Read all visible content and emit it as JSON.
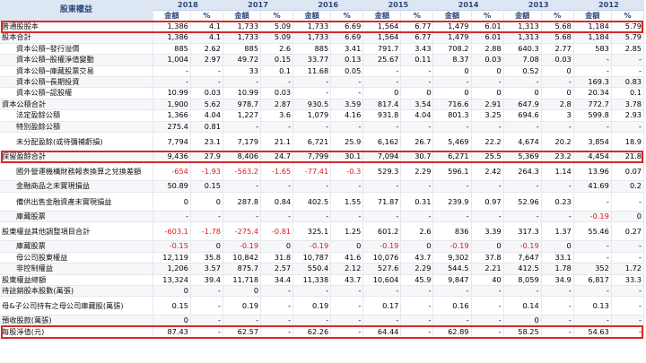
{
  "header": {
    "corner_label": "股東權益",
    "years": [
      "2018",
      "2017",
      "2016",
      "2015",
      "2014",
      "2013",
      "2012"
    ],
    "amount_label": "金額",
    "pct_label": "%"
  },
  "rows": [
    {
      "label": "普通股股本",
      "indent": 0,
      "highlight": true,
      "vals": [
        [
          "1,386",
          "4.1"
        ],
        [
          "1,733",
          "5.09"
        ],
        [
          "1,733",
          "6.69"
        ],
        [
          "1,564",
          "6.77"
        ],
        [
          "1,479",
          "6.01"
        ],
        [
          "1,313",
          "5.68"
        ],
        [
          "1,184",
          "5.79"
        ]
      ]
    },
    {
      "label": "股本合計",
      "indent": 0,
      "vals": [
        [
          "1,386",
          "4.1"
        ],
        [
          "1,733",
          "5.09"
        ],
        [
          "1,733",
          "6.69"
        ],
        [
          "1,564",
          "6.77"
        ],
        [
          "1,479",
          "6.01"
        ],
        [
          "1,313",
          "5.68"
        ],
        [
          "1,184",
          "5.79"
        ]
      ]
    },
    {
      "label": "資本公積─發行溢價",
      "indent": 1,
      "vals": [
        [
          "885",
          "2.62"
        ],
        [
          "885",
          "2.6"
        ],
        [
          "885",
          "3.41"
        ],
        [
          "791.7",
          "3.43"
        ],
        [
          "708.2",
          "2.88"
        ],
        [
          "640.3",
          "2.77"
        ],
        [
          "583",
          "2.85"
        ]
      ]
    },
    {
      "label": "資本公積─股權淨值變動",
      "indent": 1,
      "vals": [
        [
          "1,004",
          "2.97"
        ],
        [
          "49.72",
          "0.15"
        ],
        [
          "33.77",
          "0.13"
        ],
        [
          "25.67",
          "0.11"
        ],
        [
          "8.37",
          "0.03"
        ],
        [
          "7.08",
          "0.03"
        ],
        [
          "-",
          "-"
        ]
      ]
    },
    {
      "label": "資本公積─庫藏股票交易",
      "indent": 1,
      "vals": [
        [
          "-",
          "-"
        ],
        [
          "33",
          "0.1"
        ],
        [
          "11.68",
          "0.05"
        ],
        [
          "-",
          "-"
        ],
        [
          "0",
          "0"
        ],
        [
          "0.52",
          "0"
        ],
        [
          "-",
          "-"
        ]
      ]
    },
    {
      "label": "資本公積─長期投資",
      "indent": 1,
      "vals": [
        [
          "-",
          "-"
        ],
        [
          "-",
          "-"
        ],
        [
          "-",
          "-"
        ],
        [
          "-",
          "-"
        ],
        [
          "-",
          "-"
        ],
        [
          "-",
          "-"
        ],
        [
          "169.3",
          "0.83"
        ]
      ]
    },
    {
      "label": "資本公積─認股權",
      "indent": 1,
      "vals": [
        [
          "10.99",
          "0.03"
        ],
        [
          "10.99",
          "0.03"
        ],
        [
          "-",
          "-"
        ],
        [
          "0",
          "0"
        ],
        [
          "0",
          "0"
        ],
        [
          "0",
          "0"
        ],
        [
          "20.34",
          "0.1"
        ]
      ]
    },
    {
      "label": "資本公積合計",
      "indent": 0,
      "vals": [
        [
          "1,900",
          "5.62"
        ],
        [
          "978.7",
          "2.87"
        ],
        [
          "930.5",
          "3.59"
        ],
        [
          "817.4",
          "3.54"
        ],
        [
          "716.6",
          "2.91"
        ],
        [
          "647.9",
          "2.8"
        ],
        [
          "772.7",
          "3.78"
        ]
      ]
    },
    {
      "label": "法定盈餘公積",
      "indent": 1,
      "vals": [
        [
          "1,366",
          "4.04"
        ],
        [
          "1,227",
          "3.6"
        ],
        [
          "1,079",
          "4.16"
        ],
        [
          "931.8",
          "4.04"
        ],
        [
          "801.3",
          "3.25"
        ],
        [
          "694.6",
          "3"
        ],
        [
          "599.8",
          "2.93"
        ]
      ]
    },
    {
      "label": "特別盈餘公積",
      "indent": 1,
      "vals": [
        [
          "275.4",
          "0.81"
        ],
        [
          "-",
          "-"
        ],
        [
          "-",
          "-"
        ],
        [
          "-",
          "-"
        ],
        [
          "-",
          "-"
        ],
        [
          "-",
          "-"
        ],
        [
          "-",
          "-"
        ]
      ]
    },
    {
      "label": "未分配盈餘(或待彌補虧損)",
      "indent": 1,
      "tall": true,
      "vals": [
        [
          "7,794",
          "23.1"
        ],
        [
          "7,179",
          "21.1"
        ],
        [
          "6,721",
          "25.9"
        ],
        [
          "6,162",
          "26.7"
        ],
        [
          "5,469",
          "22.2"
        ],
        [
          "4,674",
          "20.2"
        ],
        [
          "3,854",
          "18.9"
        ]
      ]
    },
    {
      "label": "保留盈餘合計",
      "indent": 0,
      "highlight": true,
      "vals": [
        [
          "9,436",
          "27.9"
        ],
        [
          "8,406",
          "24.7"
        ],
        [
          "7,799",
          "30.1"
        ],
        [
          "7,094",
          "30.7"
        ],
        [
          "6,271",
          "25.5"
        ],
        [
          "5,369",
          "23.2"
        ],
        [
          "4,454",
          "21.8"
        ]
      ]
    },
    {
      "label": "國外營運機構財務報表換算之兌換差額",
      "indent": 1,
      "tall": true,
      "vals": [
        [
          "-654",
          "-1.93"
        ],
        [
          "-563.2",
          "-1.65"
        ],
        [
          "-77.41",
          "-0.3"
        ],
        [
          "529.3",
          "2.29"
        ],
        [
          "596.1",
          "2.42"
        ],
        [
          "264.3",
          "1.14"
        ],
        [
          "13.96",
          "0.07"
        ]
      ]
    },
    {
      "label": "金融商品之未實現損益",
      "indent": 1,
      "vals": [
        [
          "50.89",
          "0.15"
        ],
        [
          "-",
          "-"
        ],
        [
          "-",
          "-"
        ],
        [
          "-",
          "-"
        ],
        [
          "-",
          "-"
        ],
        [
          "-",
          "-"
        ],
        [
          "41.69",
          "0.2"
        ]
      ]
    },
    {
      "label": "備供出售金融資產未實現損益",
      "indent": 1,
      "tall": true,
      "vals": [
        [
          "0",
          "0"
        ],
        [
          "287.8",
          "0.84"
        ],
        [
          "402.5",
          "1.55"
        ],
        [
          "71.87",
          "0.31"
        ],
        [
          "239.9",
          "0.97"
        ],
        [
          "52.96",
          "0.23"
        ],
        [
          "-",
          "-"
        ]
      ]
    },
    {
      "label": "庫藏股票",
      "indent": 1,
      "vals": [
        [
          "-",
          "-"
        ],
        [
          "-",
          "-"
        ],
        [
          "-",
          "-"
        ],
        [
          "-",
          "-"
        ],
        [
          "-",
          "-"
        ],
        [
          "-",
          "-"
        ],
        [
          "-0.19",
          "0"
        ]
      ]
    },
    {
      "label": "股東權益其他調整項目合計",
      "indent": 0,
      "tall": true,
      "vals": [
        [
          "-603.1",
          "-1.78"
        ],
        [
          "-275.4",
          "-0.81"
        ],
        [
          "325.1",
          "1.25"
        ],
        [
          "601.2",
          "2.6"
        ],
        [
          "836",
          "3.39"
        ],
        [
          "317.3",
          "1.37"
        ],
        [
          "55.46",
          "0.27"
        ]
      ]
    },
    {
      "label": "庫藏股票",
      "indent": 1,
      "vals": [
        [
          "-0.15",
          "0"
        ],
        [
          "-0.19",
          "0"
        ],
        [
          "-0.19",
          "0"
        ],
        [
          "-0.19",
          "0"
        ],
        [
          "-0.19",
          "0"
        ],
        [
          "-0.19",
          "0"
        ],
        [
          "-",
          "-"
        ]
      ]
    },
    {
      "label": "母公司股東權益",
      "indent": 1,
      "vals": [
        [
          "12,119",
          "35.8"
        ],
        [
          "10,842",
          "31.8"
        ],
        [
          "10,787",
          "41.6"
        ],
        [
          "10,076",
          "43.7"
        ],
        [
          "9,302",
          "37.8"
        ],
        [
          "7,647",
          "33.1"
        ],
        [
          "-",
          "-"
        ]
      ]
    },
    {
      "label": "非控制權益",
      "indent": 1,
      "vals": [
        [
          "1,206",
          "3.57"
        ],
        [
          "875.7",
          "2.57"
        ],
        [
          "550.4",
          "2.12"
        ],
        [
          "527.6",
          "2.29"
        ],
        [
          "544.5",
          "2.21"
        ],
        [
          "412.5",
          "1.78"
        ],
        [
          "352",
          "1.72"
        ]
      ]
    },
    {
      "label": "股東權益總額",
      "indent": 0,
      "vals": [
        [
          "13,324",
          "39.4"
        ],
        [
          "11,718",
          "34.4"
        ],
        [
          "11,338",
          "43.7"
        ],
        [
          "10,604",
          "45.9"
        ],
        [
          "9,847",
          "40"
        ],
        [
          "8,059",
          "34.9"
        ],
        [
          "6,817",
          "33.3"
        ]
      ]
    },
    {
      "label": "待註銷股本股數(萬張)",
      "indent": 0,
      "vals": [
        [
          "0",
          "-"
        ],
        [
          "0",
          "-"
        ],
        [
          "-",
          "-"
        ],
        [
          "-",
          "-"
        ],
        [
          "-",
          "-"
        ],
        [
          "-",
          "-"
        ],
        [
          "-",
          "-"
        ]
      ]
    },
    {
      "label": "母&子公司持有之母公司庫藏股(萬張)",
      "indent": 0,
      "tall": true,
      "vals": [
        [
          "0.15",
          "-"
        ],
        [
          "0.19",
          "-"
        ],
        [
          "0.19",
          "-"
        ],
        [
          "0.17",
          "-"
        ],
        [
          "0.16",
          "-"
        ],
        [
          "0.14",
          "-"
        ],
        [
          "0.13",
          "-"
        ]
      ]
    },
    {
      "label": "預收股款(萬張)",
      "indent": 0,
      "vals": [
        [
          "0",
          "-"
        ],
        [
          "-",
          "-"
        ],
        [
          "-",
          "-"
        ],
        [
          "-",
          "-"
        ],
        [
          "-",
          "-"
        ],
        [
          "0",
          "-"
        ],
        [
          "-",
          "-"
        ]
      ]
    },
    {
      "label": "每股淨值(元)",
      "indent": 0,
      "highlight": true,
      "vals": [
        [
          "87.43",
          "-"
        ],
        [
          "62.57",
          "-"
        ],
        [
          "62.26",
          "-"
        ],
        [
          "64.44",
          "-"
        ],
        [
          "62.89",
          "-"
        ],
        [
          "58.25",
          "-"
        ],
        [
          "54.63",
          "-"
        ]
      ]
    }
  ],
  "colors": {
    "header_bg": "#dde6f3",
    "header_text": "#2d4777",
    "negative": "#e8151b",
    "highlight_border": "#d62a2a"
  }
}
